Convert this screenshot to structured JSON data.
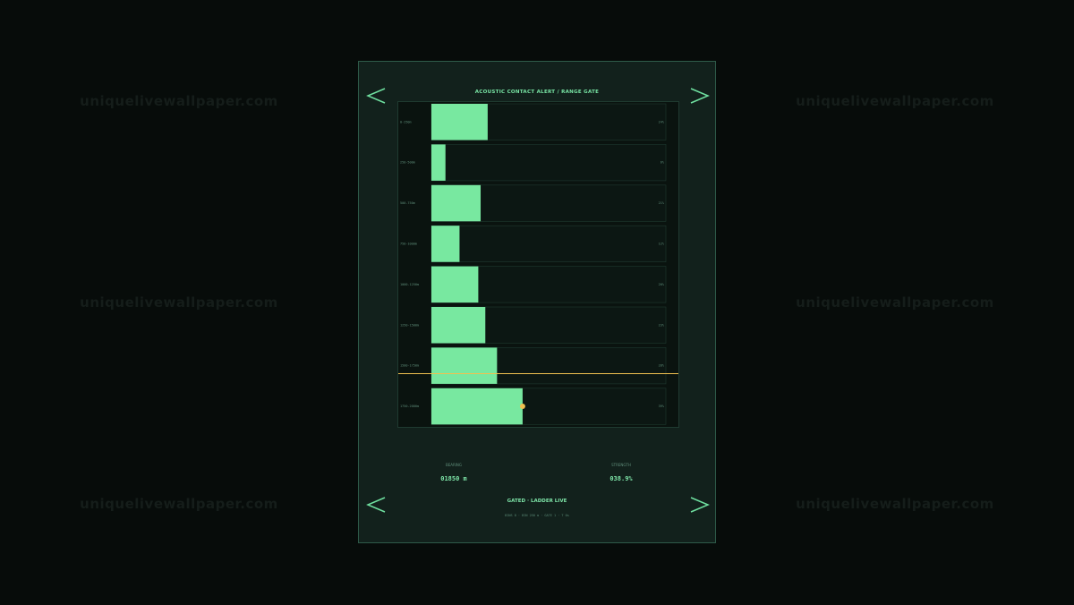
{
  "watermark": "uniquelivewallpaper.com",
  "panel": {
    "title": "ACOUSTIC CONTACT ALERT  /  RANGE GATE",
    "stats": {
      "bearing_label": "BEARING",
      "bearing_value": "01850 m",
      "strength_label": "STRENGTH",
      "strength_value": "038.9%"
    },
    "status": "GATED · LADDER LIVE",
    "footnote": "BINS 8 · BIN 250 m · GATE 1 · T 0s"
  },
  "colors": {
    "bar": "#78e8a0",
    "gate_line": "#f0c050",
    "marker": "#f0c050",
    "accent": "#6fe0a0"
  },
  "icons": [
    "chevron-left-icon",
    "chevron-right-icon"
  ],
  "chart_data": {
    "type": "bar",
    "orientation": "horizontal",
    "title": "ACOUSTIC CONTACT ALERT  /  RANGE GATE",
    "categories": [
      "0-250m",
      "250-500m",
      "500-750m",
      "750-1000m",
      "1000-1250m",
      "1250-1500m",
      "1500-1750m",
      "1750-2000m"
    ],
    "series": [
      {
        "values": [
          24,
          6,
          21,
          12,
          20,
          23,
          28,
          38.9
        ]
      }
    ],
    "value_labels": [
      "24%",
      "6%",
      "21%",
      "12%",
      "20%",
      "23%",
      "28%",
      "39%"
    ],
    "xlim": [
      0,
      100
    ],
    "gate_bin_index": 6,
    "marker_bin_index": 7,
    "grid": false
  }
}
